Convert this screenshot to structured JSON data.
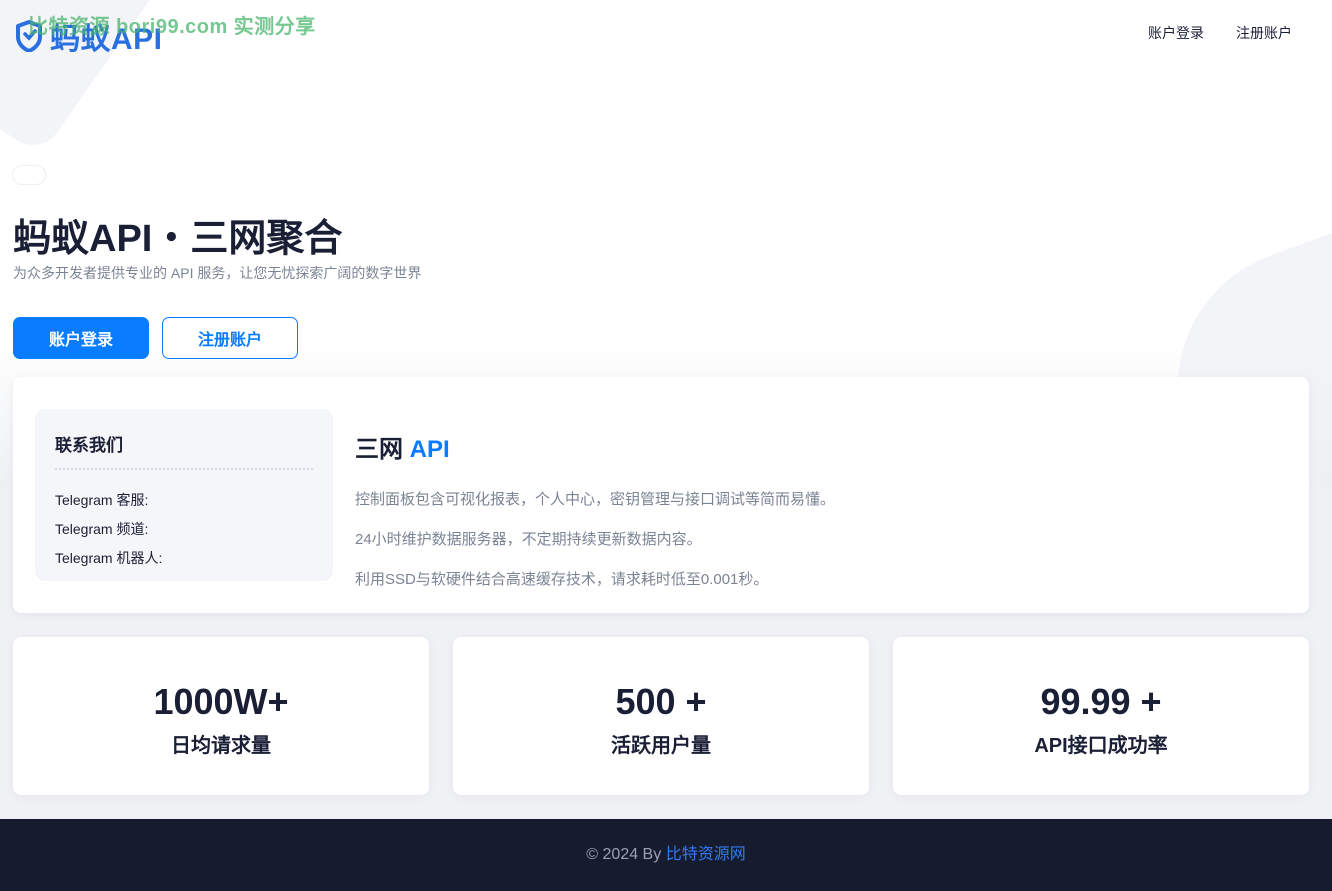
{
  "header": {
    "logo_text": "蚂蚁API",
    "watermark": "比特资源 bori99.com 实测分享",
    "nav": [
      {
        "label": "账户登录"
      },
      {
        "label": "注册账户"
      }
    ]
  },
  "hero": {
    "title": "蚂蚁API・三网聚合",
    "subtitle": "为众多开发者提供专业的 API 服务，让您无忧探索广阔的数字世界",
    "login_button": "账户登录",
    "register_button": "注册账户"
  },
  "contact": {
    "title": "联系我们",
    "items": [
      {
        "label": "Telegram 客服:"
      },
      {
        "label": "Telegram 频道:"
      },
      {
        "label": "Telegram 机器人:"
      }
    ]
  },
  "features": {
    "title_main": "三网",
    "title_accent": "API",
    "lines": [
      "控制面板包含可视化报表，个人中心，密钥管理与接口调试等简而易懂。",
      "24小时维护数据服务器，不定期持续更新数据内容。",
      "利用SSD与软硬件结合高速缓存技术，请求耗时低至0.001秒。"
    ]
  },
  "stats": [
    {
      "value": "1000W+",
      "label": "日均请求量"
    },
    {
      "value": "500 +",
      "label": "活跃用户量"
    },
    {
      "value": "99.99 +",
      "label": "API接口成功率"
    }
  ],
  "footer": {
    "prefix": "© 2024 By",
    "link": "比特资源网"
  },
  "colors": {
    "accent": "#0a7cff",
    "footer_bg": "#161b2e"
  }
}
